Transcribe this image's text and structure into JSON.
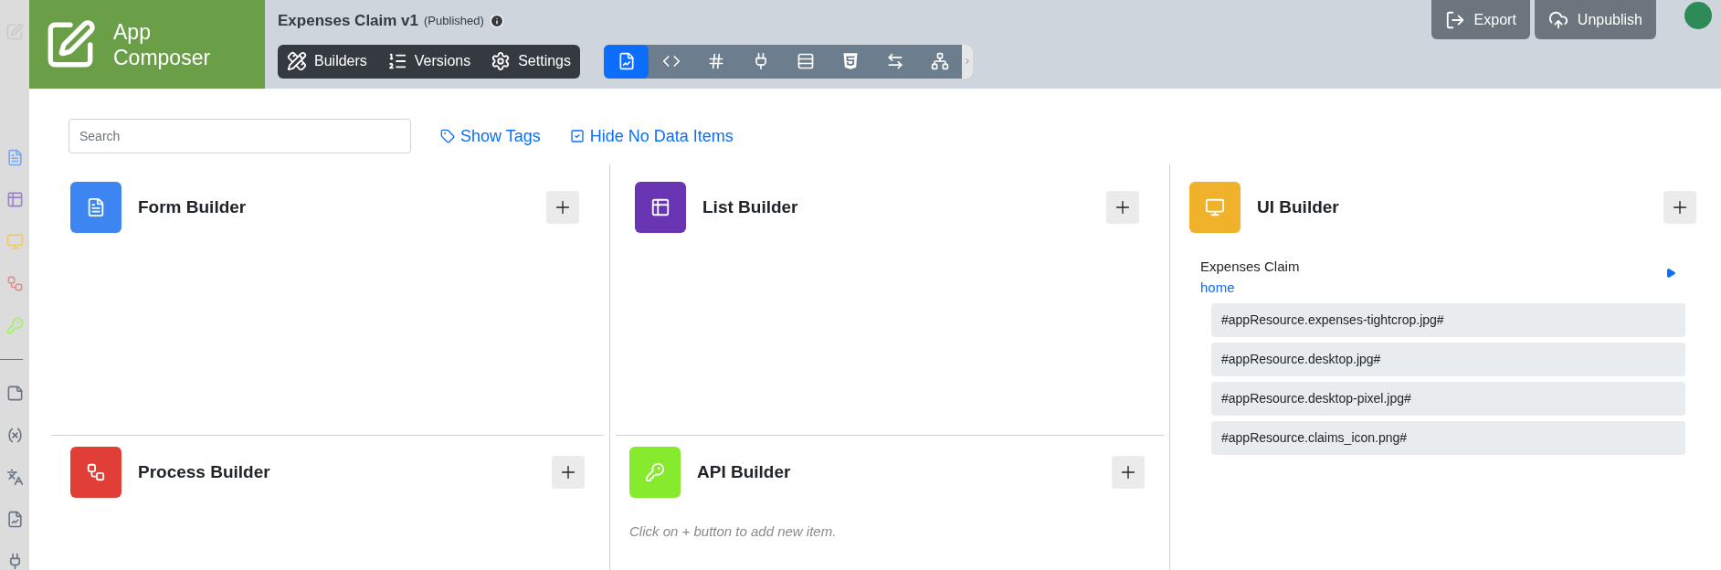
{
  "sidebar": {
    "items": [
      {
        "kind": "form"
      },
      {
        "kind": "list"
      },
      {
        "kind": "ui"
      },
      {
        "kind": "process"
      },
      {
        "kind": "api"
      },
      {
        "kind": "divider"
      },
      {
        "kind": "note"
      },
      {
        "kind": "variable"
      },
      {
        "kind": "translate"
      },
      {
        "kind": "report"
      },
      {
        "kind": "plug"
      }
    ]
  },
  "brand": {
    "name": "App Composer"
  },
  "app": {
    "title": "Expenses Claim v1",
    "status": "(Published)"
  },
  "nav": [
    {
      "kind": "builders",
      "label": "Builders"
    },
    {
      "kind": "versions",
      "label": "Versions"
    },
    {
      "kind": "settings",
      "label": "Settings"
    }
  ],
  "tool_tabs": [
    {
      "kind": "report",
      "selected": true
    },
    {
      "kind": "code",
      "selected": false
    },
    {
      "kind": "hash",
      "selected": false
    },
    {
      "kind": "plug",
      "selected": false
    },
    {
      "kind": "rows",
      "selected": false
    },
    {
      "kind": "html",
      "selected": false
    },
    {
      "kind": "swap",
      "selected": false
    },
    {
      "kind": "sitemap",
      "selected": false
    }
  ],
  "actions": [
    {
      "kind": "export",
      "label": "Export"
    },
    {
      "kind": "unpublish",
      "label": "Unpublish"
    }
  ],
  "filters": {
    "search": {
      "placeholder": "Search"
    },
    "show_tags": "Show Tags",
    "hide_no_data": "Hide No Data Items"
  },
  "builders": [
    {
      "kind": "form",
      "title": "Form Builder",
      "color": "#3d85f0"
    },
    {
      "kind": "list",
      "title": "List Builder",
      "color": "#6935b3"
    },
    {
      "kind": "ui",
      "title": "UI Builder",
      "color": "#f1b22b",
      "apps": [
        {
          "name": "Expenses Claim",
          "page": "home",
          "resources": [
            "#appResource.expenses-tightcrop.jpg#",
            "#appResource.desktop.jpg#",
            "#appResource.desktop-pixel.jpg#",
            "#appResource.claims_icon.png#"
          ]
        }
      ]
    },
    {
      "kind": "process",
      "title": "Process Builder",
      "color": "#e03e36"
    },
    {
      "kind": "api",
      "title": "API Builder",
      "color": "#86eb2d",
      "hint": "Click on + button to add new item."
    }
  ]
}
